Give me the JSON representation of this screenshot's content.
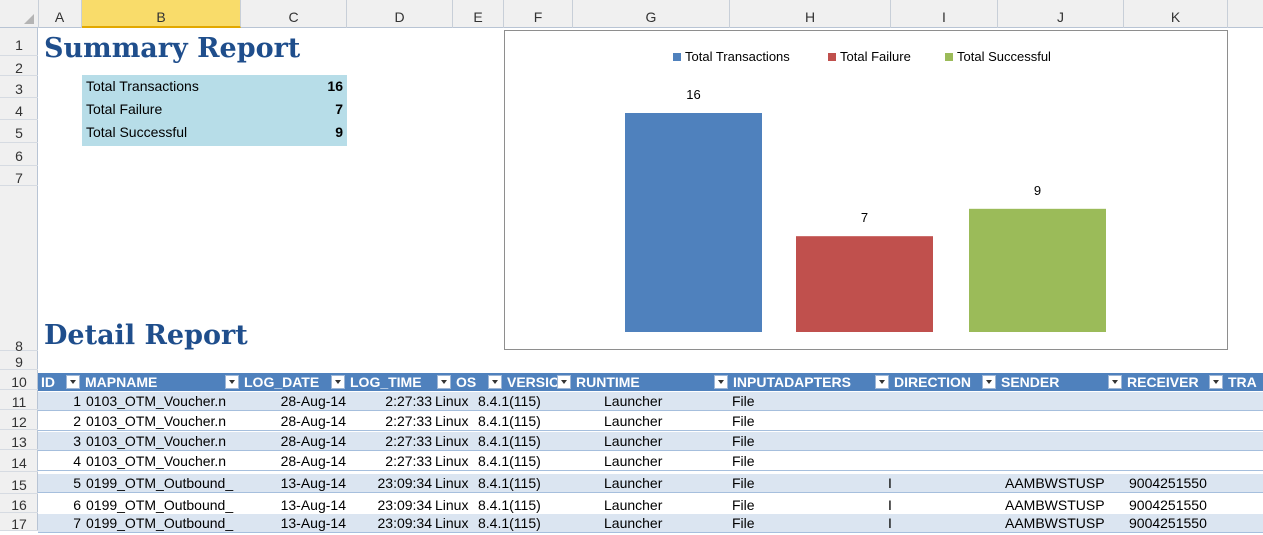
{
  "columns": [
    "A",
    "B",
    "C",
    "D",
    "E",
    "F",
    "G",
    "H",
    "I",
    "J",
    "K"
  ],
  "selected_column": "B",
  "rows": [
    "1",
    "2",
    "3",
    "4",
    "5",
    "6",
    "7",
    "8",
    "9",
    "10",
    "11",
    "12",
    "13",
    "14",
    "15",
    "16",
    "17"
  ],
  "summary": {
    "title": "Summary Report",
    "items": [
      {
        "label": "Total Transactions",
        "value": "16"
      },
      {
        "label": "Total Failure",
        "value": "7"
      },
      {
        "label": "Total Successful",
        "value": "9"
      }
    ],
    "fill_color": "#b7dde8"
  },
  "detail": {
    "title": "Detail Report"
  },
  "chart_data": {
    "type": "bar",
    "categories": [
      "Total Transactions",
      "Total Failure",
      "Total Successful"
    ],
    "series": [
      {
        "name": "Total Transactions",
        "values": [
          16
        ],
        "color": "#4f81bd"
      },
      {
        "name": "Total Failure",
        "values": [
          7
        ],
        "color": "#c0504d"
      },
      {
        "name": "Total Successful",
        "values": [
          9
        ],
        "color": "#9bbb59"
      }
    ],
    "ylim": [
      0,
      18
    ],
    "legend": "top",
    "grid": false,
    "data_labels": true
  },
  "table": {
    "headers": [
      "ID",
      "MAPNAME",
      "LOG_DATE",
      "LOG_TIME",
      "OS",
      "VERSION",
      "RUNTIME",
      "INPUTADAPTERS",
      "DIRECTION",
      "SENDER",
      "RECEIVER",
      "TRA"
    ],
    "rows": [
      [
        "1",
        "0103_OTM_Voucher.n",
        "28-Aug-14",
        "2:27:33",
        "Linux",
        "8.4.1(115)",
        "Launcher",
        "File",
        "",
        "",
        ""
      ],
      [
        "2",
        "0103_OTM_Voucher.n",
        "28-Aug-14",
        "2:27:33",
        "Linux",
        "8.4.1(115)",
        "Launcher",
        "File",
        "",
        "",
        ""
      ],
      [
        "3",
        "0103_OTM_Voucher.n",
        "28-Aug-14",
        "2:27:33",
        "Linux",
        "8.4.1(115)",
        "Launcher",
        "File",
        "",
        "",
        ""
      ],
      [
        "4",
        "0103_OTM_Voucher.n",
        "28-Aug-14",
        "2:27:33",
        "Linux",
        "8.4.1(115)",
        "Launcher",
        "File",
        "",
        "",
        ""
      ],
      [
        "5",
        "0199_OTM_Outbound_",
        "13-Aug-14",
        "23:09:34",
        "Linux",
        "8.4.1(115)",
        "Launcher",
        "File",
        "I",
        "AAMBWSTUSP",
        "9004251550"
      ],
      [
        "6",
        "0199_OTM_Outbound_",
        "13-Aug-14",
        "23:09:34",
        "Linux",
        "8.4.1(115)",
        "Launcher",
        "File",
        "I",
        "AAMBWSTUSP",
        "9004251550"
      ],
      [
        "7",
        "0199_OTM_Outbound_",
        "13-Aug-14",
        "23:09:34",
        "Linux",
        "8.4.1(115)",
        "Launcher",
        "File",
        "I",
        "AAMBWSTUSP",
        "9004251550"
      ]
    ]
  },
  "colors": {
    "header_blue": "#4f81bd",
    "band": "#dbe5f1",
    "title": "#1f4e8c",
    "selected_col": "#f9dc6a"
  }
}
